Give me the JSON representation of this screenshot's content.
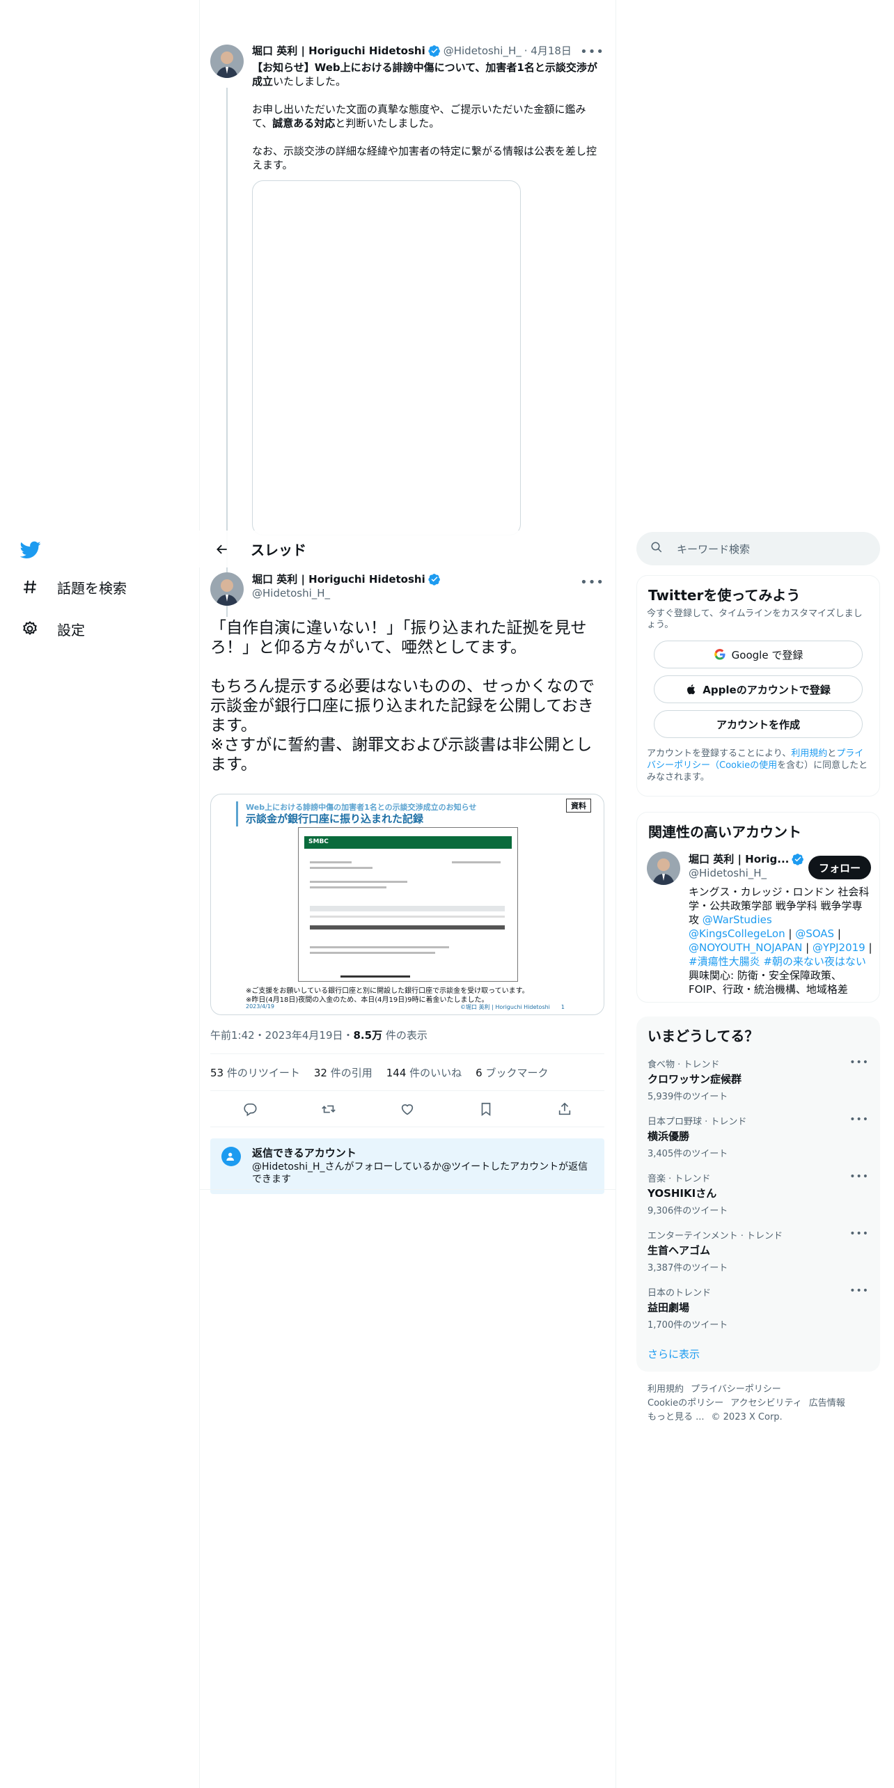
{
  "nav": {
    "items": [
      {
        "label": "話題を検索",
        "icon": "hashtag-icon"
      },
      {
        "label": "設定",
        "icon": "gear-icon"
      }
    ]
  },
  "header": {
    "title": "スレッド"
  },
  "parent_tweet": {
    "display_name": "堀口 英利 | Horiguchi Hidetoshi",
    "handle": "@Hidetoshi_H_",
    "date": "· 4月18日",
    "text_1a": "【お知らせ】Web上における誹謗中傷について、加害者1名と示談交渉が成立",
    "text_1b": "いたしました。",
    "text_2a": "お申し出いただいた文面の真摯な態度や、ご提示いただいた金額に鑑みて、",
    "text_2b": "誠意ある対応",
    "text_2c": "と判断いたしました。",
    "text_3": "なお、示談交渉の詳細な経緯や加害者の特定に繋がる情報は公表を差し控えます。"
  },
  "main_tweet": {
    "display_name": "堀口 英利 | Horiguchi Hidetoshi",
    "handle": "@Hidetoshi_H_",
    "text_1": "「自作自演に違いない！」「振り込まれた証拠を見せろ！」と仰る方々がいて、唖然としてます。",
    "text_2": "もちろん提示する必要はないものの、せっかくなので示談金が銀行口座に振り込まれた記録を公開しておきます。",
    "text_3": "※さすがに誓約書、謝罪文および示談書は非公開とします。",
    "media": {
      "label": "資料",
      "subtitle": "Web上における誹謗中傷の加害者1名との示談交渉成立のお知らせ",
      "title": "示談金が銀行口座に振り込まれた記録",
      "bank": "SMBC",
      "note_1": "※ご支援をお願いしている銀行口座と別に開設した銀行口座で示談金を受け取っています。",
      "note_2": "※昨日(4月18日)夜間の入金のため、本日(4月19日)9時に着金いたしました。",
      "date": "2023/4/19",
      "credit": "©堀口 英利 | Horiguchi Hidetoshi　　1"
    },
    "time": "午前1:42・2023年4月19日・",
    "views_count": "8.5万",
    "views_label": " 件の表示",
    "stats": [
      {
        "count": "53",
        "label": " 件のリツイート"
      },
      {
        "count": "32",
        "label": " 件の引用"
      },
      {
        "count": "144",
        "label": " 件のいいね"
      },
      {
        "count": "6",
        "label": " ブックマーク"
      }
    ],
    "reply_restriction_title": "返信できるアカウント",
    "reply_restriction_desc": "@Hidetoshi_H_さんがフォローしているか@ツイートしたアカウントが返信できます"
  },
  "search": {
    "placeholder": "キーワード検索"
  },
  "signup": {
    "title": "Twitterを使ってみよう",
    "subtitle": "今すぐ登録して、タイムラインをカスタマイズしましょう。",
    "google": "Google で登録",
    "apple": "Appleのアカウントで登録",
    "create": "アカウントを作成",
    "legal_1": "アカウントを登録することにより、",
    "legal_link_1": "利用規約",
    "legal_2": "と",
    "legal_link_2": "プライバシーポリシー（Cookieの使用",
    "legal_3": "を含む）に同意したとみなされます。"
  },
  "related": {
    "title": "関連性の高いアカウント",
    "name": "堀口 英利 | Horig...",
    "handle": "@Hidetoshi_H_",
    "follow": "フォロー",
    "bio_1": "キングス・カレッジ・ロンドン 社会科学・公共政策学部 戦争学科 戦争学専攻 ",
    "bio_link_1": "@WarStudies",
    "bio_link_2": "@KingsCollegeLon",
    "bio_sep_1": " | ",
    "bio_link_3": "@SOAS",
    "bio_sep_2": " | ",
    "bio_link_4": "@NOYOUTH_NOJAPAN",
    "bio_sep_3": " | ",
    "bio_link_5": "@YPJ2019",
    "bio_sep_4": " | ",
    "bio_link_6": "#潰瘍性大腸炎 #朝の来ない夜はない",
    "bio_2": "興味関心: 防衛・安全保障政策、FOIP、行政・統治機構、地域格差"
  },
  "trends": {
    "title": "いまどうしてる？",
    "items": [
      {
        "category": "食べ物 · トレンド",
        "name": "クロワッサン症候群",
        "count": "5,939件のツイート"
      },
      {
        "category": "日本プロ野球 · トレンド",
        "name": "横浜優勝",
        "count": "3,405件のツイート"
      },
      {
        "category": "音楽 · トレンド",
        "name": "YOSHIKIさん",
        "count": "9,306件のツイート"
      },
      {
        "category": "エンターテインメント · トレンド",
        "name": "生首ヘアゴム",
        "count": "3,387件のツイート"
      },
      {
        "category": "日本のトレンド",
        "name": "益田劇場",
        "count": "1,700件のツイート"
      }
    ],
    "show_more": "さらに表示"
  },
  "footer": {
    "terms": "利用規約",
    "privacy": "プライバシーポリシー",
    "cookie": "Cookieのポリシー",
    "accessibility": "アクセシビリティ",
    "ads": "広告情報",
    "more": "もっと見る ...",
    "copyright": "© 2023 X Corp."
  }
}
